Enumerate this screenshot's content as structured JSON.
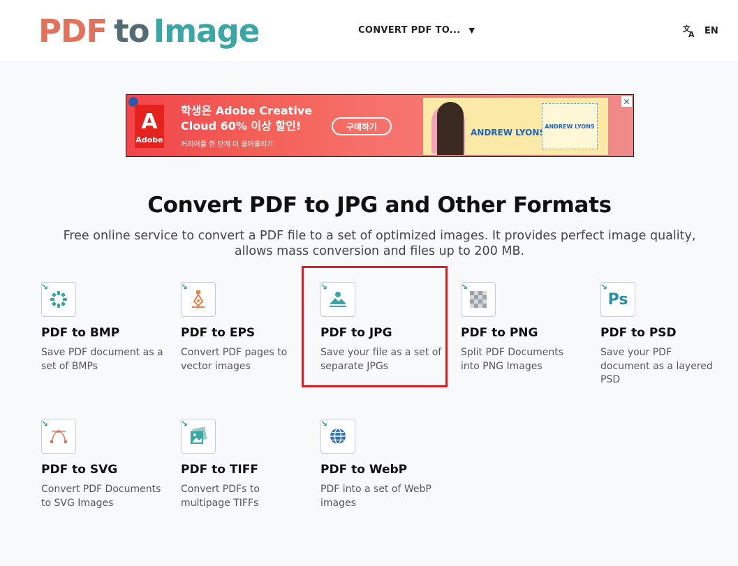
{
  "header": {
    "logo": {
      "part1": "PDF",
      "part2": "to",
      "part3": "Image"
    },
    "nav_convert": "CONVERT PDF TO...",
    "caret": "▼",
    "lang": "EN"
  },
  "ad": {
    "brand": "Adobe",
    "headline": "학생은 Adobe Creative Cloud 60% 이상 할인!",
    "subline": "커리어를 한 단계 더 끌어올리기",
    "button": "구매하기",
    "name": "ANDREW LYONS",
    "name_small": "ANDREW LYONS"
  },
  "main": {
    "title": "Convert PDF to JPG and Other Formats",
    "subtitle": "Free online service to convert a PDF file to a set of optimized images. It provides perfect image quality, allows mass conversion and files up to 200 MB."
  },
  "tools": [
    {
      "name": "PDF to BMP",
      "desc": "Save PDF document as a set of BMPs",
      "icon": "bmp-icon"
    },
    {
      "name": "PDF to EPS",
      "desc": "Convert PDF pages to vector images",
      "icon": "eps-icon"
    },
    {
      "name": "PDF to JPG",
      "desc": "Save your file as a set of separate JPGs",
      "icon": "jpg-icon"
    },
    {
      "name": "PDF to PNG",
      "desc": "Split PDF Documents into PNG Images",
      "icon": "png-icon"
    },
    {
      "name": "PDF to PSD",
      "desc": "Save your PDF document as a layered PSD",
      "icon": "psd-icon",
      "icon_text": "Ps"
    },
    {
      "name": "PDF to SVG",
      "desc": "Convert PDF Documents to SVG Images",
      "icon": "svg-icon"
    },
    {
      "name": "PDF to TIFF",
      "desc": "Convert PDFs to multipage TIFFs",
      "icon": "tiff-icon"
    },
    {
      "name": "PDF to WebP",
      "desc": "PDF into a set of WebP images",
      "icon": "webp-icon"
    }
  ],
  "colors": {
    "logo_pdf": "#e2725b",
    "logo_to": "#556b74",
    "logo_image": "#3aa7a5",
    "highlight": "#e21b27",
    "accent": "#2aa08d"
  }
}
